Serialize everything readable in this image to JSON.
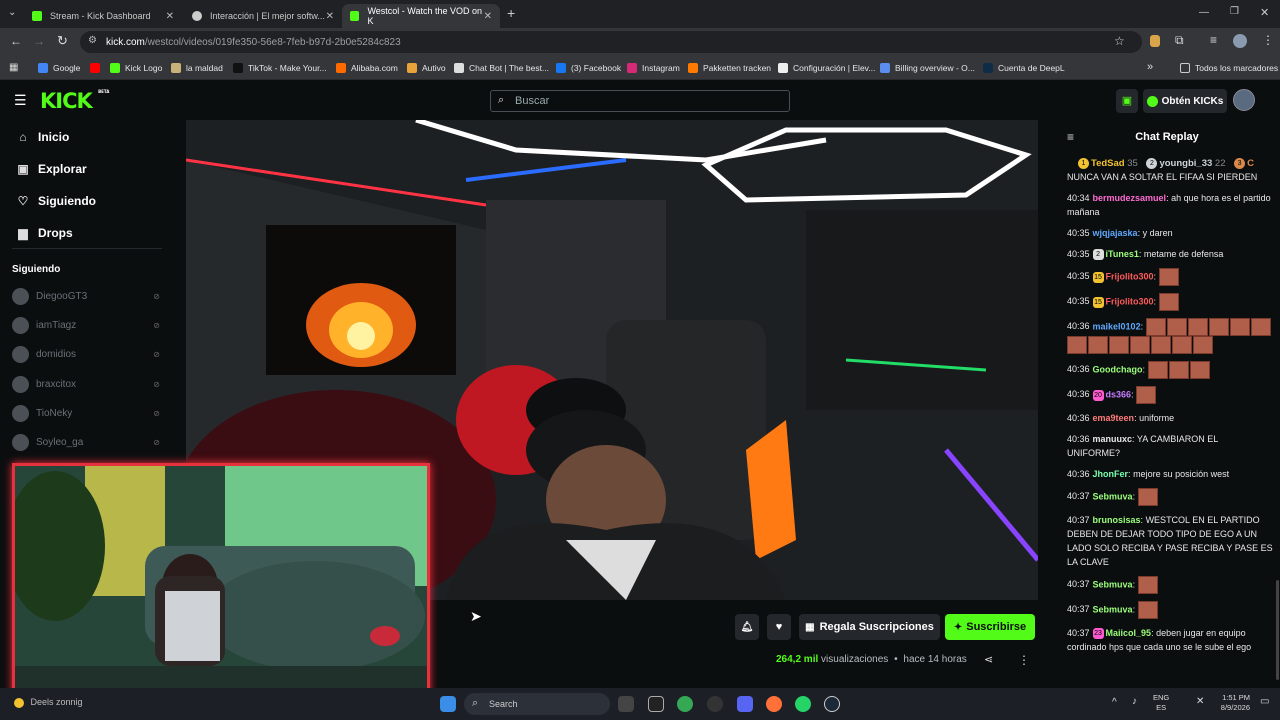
{
  "browser": {
    "tabs": [
      {
        "title": "Stream - Kick Dashboard",
        "active": false,
        "color": "#53fc18"
      },
      {
        "title": "Interacción | El mejor softw...",
        "active": false,
        "color": "#cccccc"
      },
      {
        "title": "Westcol - Watch the VOD on K",
        "active": true,
        "color": "#53fc18"
      }
    ],
    "new_tab": "+",
    "url_domain": "kick.com",
    "url_path": "/westcol/videos/019fe350-56e8-7feb-b97d-2b0e5284c823",
    "bookmarks": [
      {
        "label": "Google",
        "color": "#4285f4"
      },
      {
        "label": "",
        "color": "#ff0000"
      },
      {
        "label": "Kick Logo",
        "color": "#53fc18"
      },
      {
        "label": "la maldad",
        "color": "#c9b27a"
      },
      {
        "label": "TikTok - Make Your...",
        "color": "#111111"
      },
      {
        "label": "Alibaba.com",
        "color": "#ff6a00"
      },
      {
        "label": "Autivo",
        "color": "#e8a33a"
      },
      {
        "label": "Chat Bot | The best...",
        "color": "#dddddd"
      },
      {
        "label": "(3) Facebook",
        "color": "#1877f2"
      },
      {
        "label": "Instagram",
        "color": "#d62976"
      },
      {
        "label": "Pakketten tracken",
        "color": "#ff7a00"
      },
      {
        "label": "Configuración | Elev...",
        "color": "#eeeeee"
      },
      {
        "label": "Billing overview - O...",
        "color": "#5b8def"
      },
      {
        "label": "Cuenta de DeepL",
        "color": "#0f2b46"
      }
    ],
    "bookmarks_more": "»",
    "all_bookmarks": "Todos los marcadores"
  },
  "kick": {
    "logo": "KICK",
    "logo_badge": "BETA",
    "search_placeholder": "Buscar",
    "get_kicks": "Obtén KICKs",
    "accent": "#53fc18"
  },
  "sidebar": {
    "nav": [
      {
        "label": "Inicio",
        "icon": "⌂"
      },
      {
        "label": "Explorar",
        "icon": "▣"
      },
      {
        "label": "Siguiendo",
        "icon": "♡"
      },
      {
        "label": "Drops",
        "icon": "▆"
      }
    ],
    "following_title": "Siguiendo",
    "following": [
      "DiegooGT3",
      "iamTiagz",
      "domidios",
      "braxcitox",
      "TioNeky",
      "Soyleo_ga"
    ]
  },
  "video_actions": {
    "gift": "Regala Suscripciones",
    "subscribe": "Suscribirse",
    "views": "264,2 mil",
    "views_label": "visualizaciones",
    "time": "hace 14 horas",
    "dot": "•"
  },
  "chat": {
    "title": "Chat Replay",
    "leaders": [
      {
        "name": "TedSad",
        "score": "35"
      },
      {
        "name": "youngbi_33",
        "score": "22"
      },
      {
        "name": "C",
        "score": ""
      }
    ],
    "messages": [
      {
        "time": "",
        "user": "",
        "color": "#e8e8e8",
        "text": "NUNCA VAN A SOLTAR EL FIFAA SI PIERDEN",
        "emotes": 0,
        "badge": ""
      },
      {
        "time": "40:34",
        "user": "bermudezsamuel",
        "color": "#ff6bd3",
        "text": "ah que hora es el partido mañana",
        "emotes": 0,
        "badge": ""
      },
      {
        "time": "40:35",
        "user": "wjqjajaska",
        "color": "#5fa8ff",
        "text": "y daren",
        "emotes": 0,
        "badge": ""
      },
      {
        "time": "40:35",
        "user": "iTunes1",
        "color": "#9bff7a",
        "text": "metame de defensa",
        "emotes": 0,
        "badge": "2"
      },
      {
        "time": "40:35",
        "user": "Frijolito300",
        "color": "#ff5a5a",
        "text": "",
        "emotes": 1,
        "badge": "15"
      },
      {
        "time": "40:35",
        "user": "Frijolito300",
        "color": "#ff5a5a",
        "text": "",
        "emotes": 1,
        "badge": "15"
      },
      {
        "time": "40:36",
        "user": "maikel0102",
        "color": "#5fa8ff",
        "text": "",
        "emotes": 13,
        "badge": ""
      },
      {
        "time": "40:36",
        "user": "Goodchago",
        "color": "#9bff7a",
        "text": "",
        "emotes": 3,
        "badge": ""
      },
      {
        "time": "40:36",
        "user": "ds366",
        "color": "#c77dff",
        "text": "",
        "emotes": 1,
        "badge": "20"
      },
      {
        "time": "40:36",
        "user": "ema9teen",
        "color": "#ff7a7a",
        "text": "uniforme",
        "emotes": 0,
        "badge": ""
      },
      {
        "time": "40:36",
        "user": "manuuxc",
        "color": "#e8e8e8",
        "text": "YA CAMBIARON EL UNIFORME?",
        "emotes": 0,
        "badge": ""
      },
      {
        "time": "40:36",
        "user": "JhonFer",
        "color": "#7affb0",
        "text": "mejore su posición west",
        "emotes": 0,
        "badge": ""
      },
      {
        "time": "40:37",
        "user": "Sebmuva",
        "color": "#9bff7a",
        "text": "",
        "emotes": 1,
        "badge": ""
      },
      {
        "time": "40:37",
        "user": "brunosisas",
        "color": "#9bff7a",
        "text": "WESTCOL EN EL PARTIDO DEBEN DE DEJAR TODO TIPO DE EGO A UN LADO SOLO RECIBA Y PASE RECIBA Y PASE ES LA CLAVE",
        "emotes": 0,
        "badge": ""
      },
      {
        "time": "40:37",
        "user": "Sebmuva",
        "color": "#9bff7a",
        "text": "",
        "emotes": 1,
        "badge": ""
      },
      {
        "time": "40:37",
        "user": "Sebmuva",
        "color": "#9bff7a",
        "text": "",
        "emotes": 1,
        "badge": ""
      },
      {
        "time": "40:37",
        "user": "Maiicol_95",
        "color": "#9bff7a",
        "text": "deben jugar en equipo cordinado hps que cada uno se le sube el ego",
        "emotes": 0,
        "badge": "23"
      }
    ]
  },
  "taskbar": {
    "weather": "Deels zonnig",
    "search": "Search",
    "lang1": "ENG",
    "lang2": "ES",
    "time": "1:51 PM",
    "date": "8/9/2026"
  }
}
